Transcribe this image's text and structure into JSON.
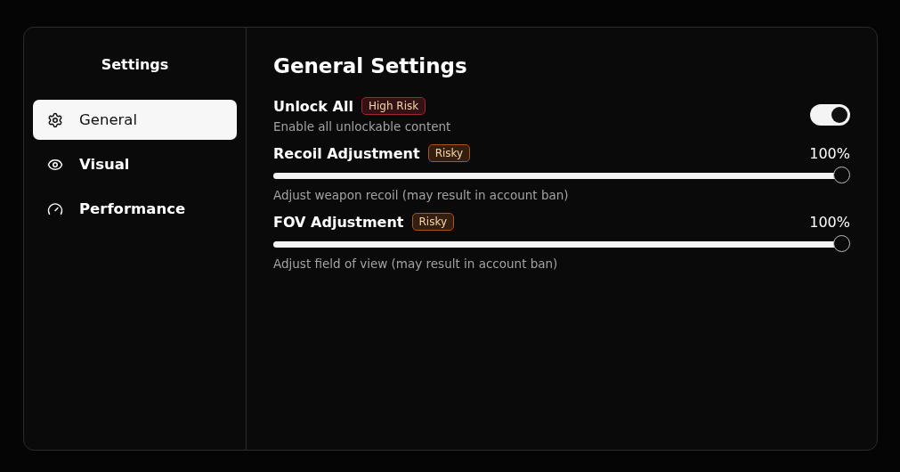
{
  "sidebar": {
    "title": "Settings",
    "items": [
      {
        "label": "General",
        "selected": true
      },
      {
        "label": "Visual",
        "selected": false
      },
      {
        "label": "Performance",
        "selected": false
      }
    ]
  },
  "main": {
    "title": "General Settings",
    "settings": [
      {
        "kind": "toggle",
        "label": "Unlock All",
        "badge": {
          "text": "High Risk",
          "color": "#a3282e"
        },
        "description": "Enable all unlockable content",
        "on": true
      },
      {
        "kind": "slider",
        "label": "Recoil Adjustment",
        "badge": {
          "text": "Risky",
          "color": "#a5561e"
        },
        "reading": "100%",
        "level": 1,
        "description": "Adjust weapon recoil (may result in account ban)"
      },
      {
        "kind": "slider",
        "label": "FOV Adjustment",
        "badge": {
          "text": "Risky",
          "color": "#a5561e"
        },
        "reading": "100%",
        "level": 1,
        "description": "Adjust field of view (may result in account ban)"
      }
    ]
  }
}
